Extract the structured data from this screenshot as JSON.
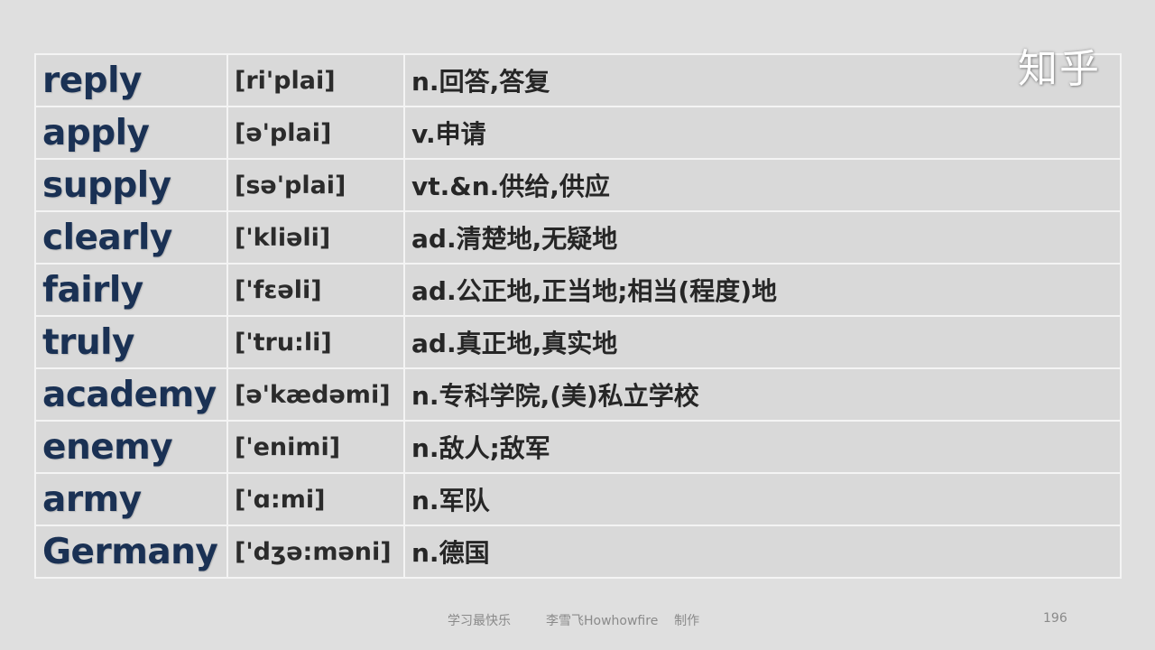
{
  "watermark": "知乎",
  "vocab": [
    {
      "word": "reply",
      "ipa": "[ri'plai]",
      "meaning": "n.回答,答复"
    },
    {
      "word": "apply",
      "ipa": "[ə'plai]",
      "meaning": "v.申请"
    },
    {
      "word": "supply",
      "ipa": "[sə'plai]",
      "meaning": "vt.&n.供给,供应"
    },
    {
      "word": "clearly",
      "ipa": "['kliəli]",
      "meaning": "ad.清楚地,无疑地"
    },
    {
      "word": "fairly",
      "ipa": "['fεəli]",
      "meaning": "ad.公正地,正当地;相当(程度)地"
    },
    {
      "word": "truly",
      "ipa": "['tru:li]",
      "meaning": "ad.真正地,真实地"
    },
    {
      "word": "academy",
      "ipa": "[ə'kædəmi]",
      "meaning": "n.专科学院,(美)私立学校"
    },
    {
      "word": "enemy",
      "ipa": "['enimi]",
      "meaning": "n.敌人;敌军"
    },
    {
      "word": "army",
      "ipa": "['ɑ:mi]",
      "meaning": "n.军队"
    },
    {
      "word": "Germany",
      "ipa": "['dʒə:məni]",
      "meaning": "n.德国"
    }
  ],
  "footer": {
    "left_text": "学习最快乐",
    "credit": "李雪飞Howhowfire    制作",
    "page_number": "196"
  }
}
